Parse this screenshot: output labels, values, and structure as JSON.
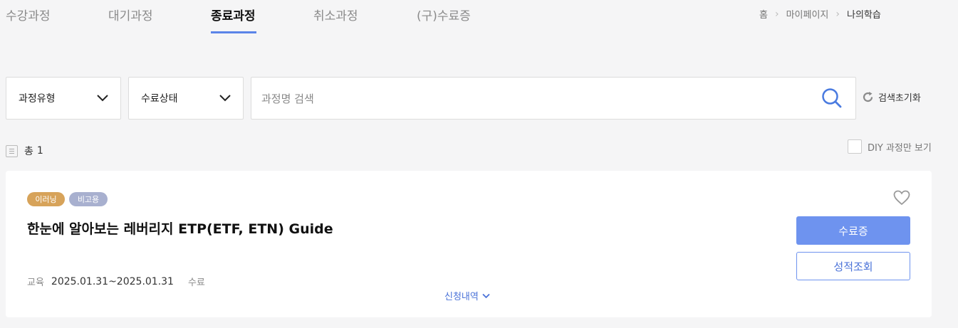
{
  "tabs": [
    {
      "label": "수강과정",
      "active": false
    },
    {
      "label": "대기과정",
      "active": false
    },
    {
      "label": "종료과정",
      "active": true
    },
    {
      "label": "취소과정",
      "active": false
    },
    {
      "label": "(구)수료증",
      "active": false
    }
  ],
  "breadcrumb": [
    "홈",
    "마이페이지",
    "나의학습"
  ],
  "filters": {
    "course_type": "과정유형",
    "completion_status": "수료상태",
    "search_placeholder": "과정명 검색",
    "reset_label": "검색초기화"
  },
  "summary": {
    "total_label": "총",
    "total_count": "1",
    "diy_only_label": "DIY 과정만 보기",
    "diy_only_checked": false
  },
  "courses": [
    {
      "badges": [
        {
          "label": "이러닝",
          "color": "#d7a35a"
        },
        {
          "label": "비고용",
          "color": "#a8b0cf"
        }
      ],
      "title": "한눈에 알아보는 레버리지 ETP(ETF, ETN) Guide",
      "period_label": "교육",
      "period": "2025.01.31~2025.01.31",
      "status": "수료",
      "favorite": false,
      "certificate_button": "수료증",
      "grade_button": "성적조회",
      "history_label": "신청내역"
    }
  ],
  "colors": {
    "accent": "#5b84e8",
    "primary_button": "#6e93ef"
  }
}
